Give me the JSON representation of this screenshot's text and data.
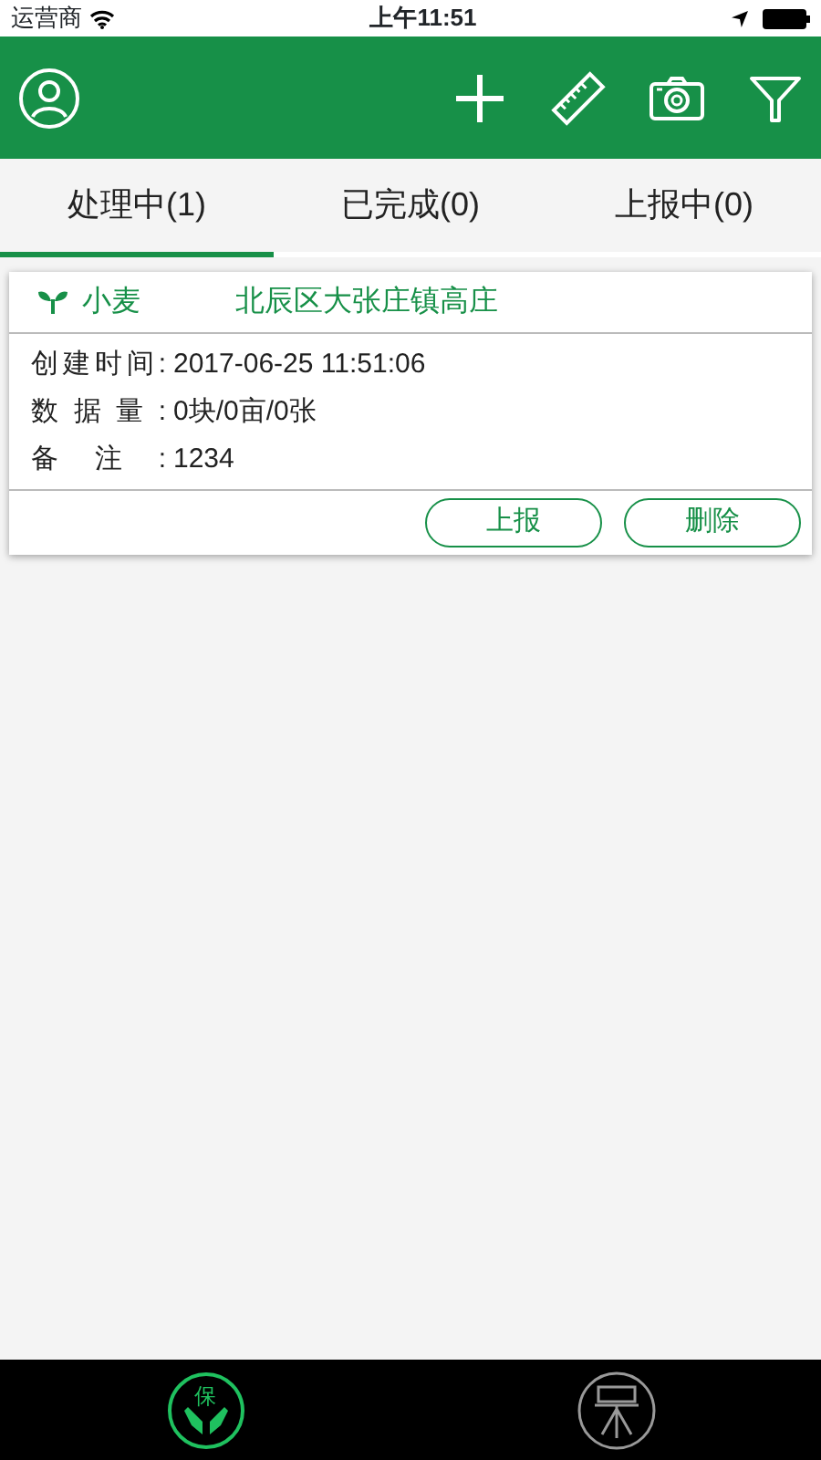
{
  "status_bar": {
    "carrier": "运营商",
    "time": "上午11:51"
  },
  "toolbar": {
    "actions": [
      {
        "kind": "add"
      },
      {
        "kind": "ruler"
      },
      {
        "kind": "camera"
      },
      {
        "kind": "filter"
      }
    ]
  },
  "tabs": [
    {
      "label": "处理中(1)",
      "selected": true
    },
    {
      "label": "已完成(0)",
      "selected": false
    },
    {
      "label": "上报中(0)",
      "selected": false
    }
  ],
  "records": [
    {
      "crop": "小麦",
      "location": "北辰区大张庄镇高庄",
      "fields": [
        {
          "label": "创建时间:",
          "value": "2017-06-25 11:51:06"
        },
        {
          "label": "数据量:",
          "value": "0块/0亩/0张"
        },
        {
          "label": "备注:",
          "value": "1234"
        }
      ],
      "buttons": [
        "上报",
        "删除"
      ]
    }
  ],
  "bottom_tabs": [
    {
      "kind": "protect",
      "glyph": "保",
      "selected": true
    },
    {
      "kind": "instrument",
      "selected": false
    }
  ]
}
